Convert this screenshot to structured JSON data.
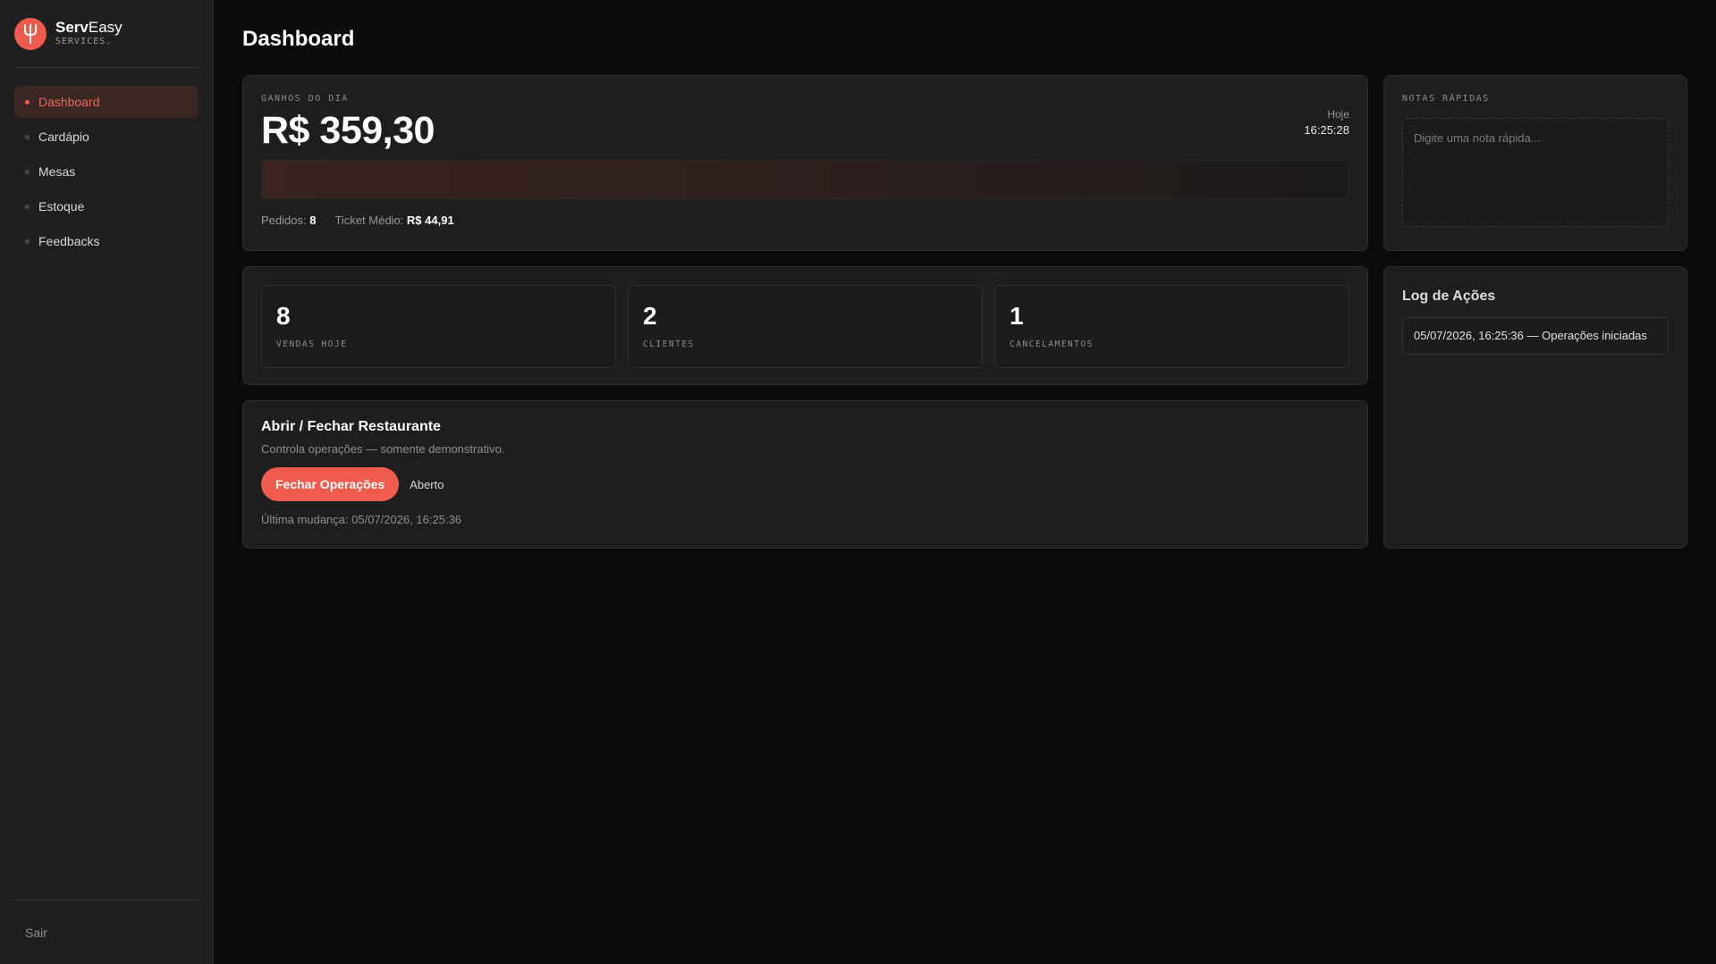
{
  "brand": {
    "name_bold": "Serv",
    "name_light": "Easy",
    "sub": "SERVICES.",
    "logo_icon": "fork-icon",
    "accent": "#ef5b4c"
  },
  "sidebar": {
    "items": [
      {
        "label": "Dashboard",
        "active": true
      },
      {
        "label": "Cardápio"
      },
      {
        "label": "Mesas"
      },
      {
        "label": "Estoque"
      },
      {
        "label": "Feedbacks"
      }
    ],
    "logout": "Sair"
  },
  "page": {
    "title": "Dashboard"
  },
  "earnings": {
    "label": "GANHOS DO DIA",
    "amount": "R$ 359,30",
    "time_label": "Hoje",
    "time_value": "16:25:28",
    "orders_label": "Pedidos:",
    "orders_value": "8",
    "ticket_label": "Ticket Médio:",
    "ticket_value": "R$ 44,91"
  },
  "notes": {
    "label": "NOTAS RÁPIDAS",
    "placeholder": "Digite uma nota rápida..."
  },
  "stats": [
    {
      "value": "8",
      "label": "VENDAS HOJE"
    },
    {
      "value": "2",
      "label": "CLIENTES"
    },
    {
      "value": "1",
      "label": "CANCELAMENTOS"
    }
  ],
  "restaurant": {
    "title": "Abrir / Fechar Restaurante",
    "desc": "Controla operações — somente demonstrativo.",
    "button": "Fechar Operações",
    "status": "Aberto",
    "last_change": "Última mudança: 05/07/2026, 16:25:36"
  },
  "log": {
    "title": "Log de Ações",
    "entries": [
      "05/07/2026, 16:25:36 — Operações iniciadas"
    ]
  }
}
